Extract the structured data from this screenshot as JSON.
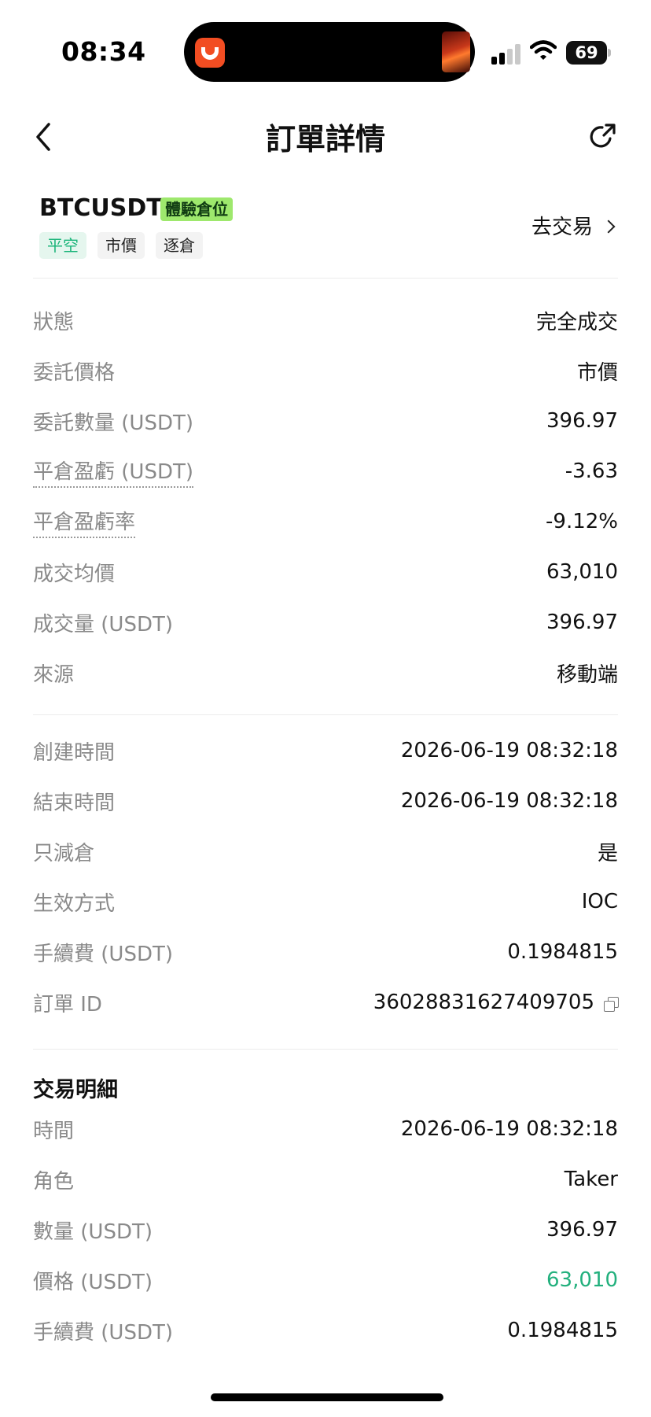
{
  "status_bar": {
    "time": "08:34",
    "battery": "69",
    "battery_level": 0.69,
    "icons": [
      "tomato-app-icon",
      "album-art-icon",
      "signal-icon",
      "wifi-icon",
      "battery-icon"
    ]
  },
  "nav": {
    "title": "訂單詳情",
    "back_icon": "chevron-left-icon",
    "share_icon": "share-icon"
  },
  "header": {
    "symbol": "BTCUSDT",
    "badge": "體驗倉位",
    "tags": [
      "平空",
      "市價",
      "逐倉"
    ],
    "go_trade": "去交易"
  },
  "details": [
    {
      "label": "狀態",
      "value": "完全成交"
    },
    {
      "label": "委託價格",
      "value": "市價"
    },
    {
      "label": "委託數量 (USDT)",
      "value": "396.97"
    },
    {
      "label": "平倉盈虧 (USDT)",
      "value": "-3.63"
    },
    {
      "label": "平倉盈虧率",
      "value": "-9.12%"
    },
    {
      "label": "成交均價",
      "value": "63,010"
    },
    {
      "label": "成交量 (USDT)",
      "value": "396.97"
    },
    {
      "label": "來源",
      "value": "移動端"
    }
  ],
  "details2": [
    {
      "label": "創建時間",
      "value": "2026-06-19 08:32:18"
    },
    {
      "label": "結束時間",
      "value": "2026-06-19 08:32:18"
    },
    {
      "label": "只減倉",
      "value": "是"
    },
    {
      "label": "生效方式",
      "value": "IOC"
    },
    {
      "label": "手續費 (USDT)",
      "value": "0.1984815"
    },
    {
      "label": "訂單 ID",
      "value": "360288316274097​05"
    }
  ],
  "trade_details": {
    "title": "交易明細",
    "rows": [
      {
        "label": "時間",
        "value": "2026-06-19 08:32:18"
      },
      {
        "label": "角色",
        "value": "Taker"
      },
      {
        "label": "數量 (USDT)",
        "value": "396.97"
      },
      {
        "label": "價格 (USDT)",
        "value": "63,010"
      },
      {
        "label": "手續費 (USDT)",
        "value": "0.1984815"
      }
    ]
  },
  "colors": {
    "accent_green": "#22b07d",
    "badge_green": "#9ee86d",
    "label_gray": "#8a8a8a"
  }
}
